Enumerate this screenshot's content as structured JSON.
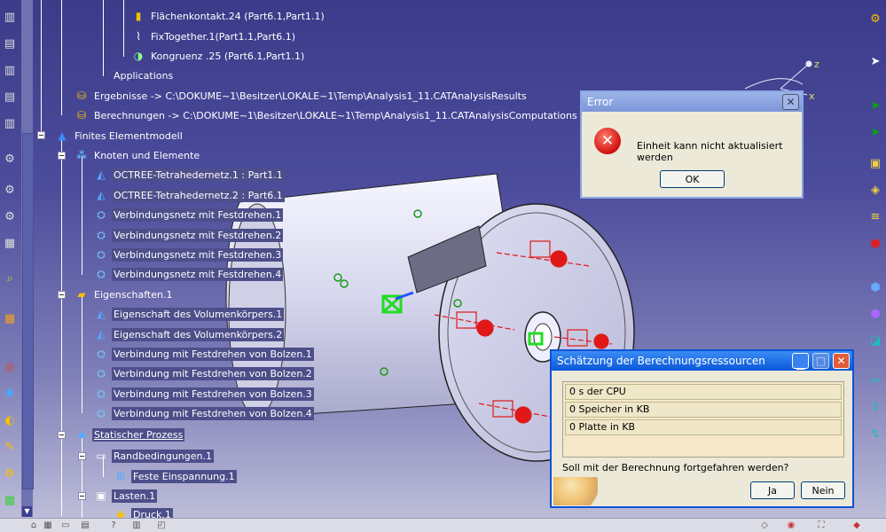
{
  "tree": {
    "rows": [
      {
        "label": "Flächenkontakt.24 (Part6.1,Part1.1)",
        "icon": "contact-icon"
      },
      {
        "label": "FixTogether.1(Part1.1,Part6.1)",
        "icon": "paperclip-icon"
      },
      {
        "label": "Kongruenz .25 (Part6.1,Part1.1)",
        "icon": "congruence-icon"
      },
      {
        "label": "Applications",
        "icon": ""
      },
      {
        "label": "Ergebnisse -> C:\\DOKUME~1\\Besitzer\\LOKALE~1\\Temp\\Analysis1_11.CATAnalysisResults",
        "icon": "results-icon"
      },
      {
        "label": "Berechnungen -> C:\\DOKUME~1\\Besitzer\\LOKALE~1\\Temp\\Analysis1_11.CATAnalysisComputations",
        "icon": "computations-icon"
      },
      {
        "label": "Finites Elementmodell",
        "icon": "fem-icon"
      },
      {
        "label": "Knoten und Elemente",
        "icon": "nodes-icon"
      },
      {
        "label": "OCTREE-Tetrahedernetz.1 : Part1.1",
        "icon": "tetra-mesh-icon"
      },
      {
        "label": "OCTREE-Tetrahedernetz.2 : Part6.1",
        "icon": "tetra-mesh-icon"
      },
      {
        "label": "Verbindungsnetz mit Festdrehen.1",
        "icon": "bolt-mesh-icon"
      },
      {
        "label": "Verbindungsnetz mit Festdrehen.2",
        "icon": "bolt-mesh-icon"
      },
      {
        "label": "Verbindungsnetz mit Festdrehen.3",
        "icon": "bolt-mesh-icon"
      },
      {
        "label": "Verbindungsnetz mit Festdrehen.4",
        "icon": "bolt-mesh-icon"
      },
      {
        "label": "Eigenschaften.1",
        "icon": "properties-folder-icon"
      },
      {
        "label": "Eigenschaft des Volumenkörpers.1",
        "icon": "solid-property-icon"
      },
      {
        "label": "Eigenschaft des Volumenkörpers.2",
        "icon": "solid-property-icon"
      },
      {
        "label": "Verbindung mit Festdrehen von Bolzen.1",
        "icon": "bolt-connection-icon"
      },
      {
        "label": "Verbindung mit Festdrehen von Bolzen.2",
        "icon": "bolt-connection-icon"
      },
      {
        "label": "Verbindung mit Festdrehen von Bolzen.3",
        "icon": "bolt-connection-icon"
      },
      {
        "label": "Verbindung mit Festdrehen von Bolzen.4",
        "icon": "bolt-connection-icon"
      },
      {
        "label": "Statischer Prozess",
        "icon": "static-case-icon"
      },
      {
        "label": "Randbedingungen.1",
        "icon": "restraints-icon"
      },
      {
        "label": "Feste Einspannung.1",
        "icon": "clamp-icon"
      },
      {
        "label": "Lasten.1",
        "icon": "loads-icon"
      },
      {
        "label": "Druck.1",
        "icon": "pressure-icon"
      }
    ]
  },
  "error_dialog": {
    "title": "Error",
    "message": "Einheit kann nicht aktualisiert werden",
    "ok_label": "OK"
  },
  "estimate_dialog": {
    "title": "Schätzung der Berechnungsressourcen",
    "rows": [
      "0 s der CPU",
      "0 Speicher in KB",
      "0 Platte in KB"
    ],
    "question": "Soll mit der Berechnung fortgefahren werden?",
    "yes_label": "Ja",
    "no_label": "Nein"
  },
  "compass": {
    "z_label": "z",
    "x_label": "x"
  },
  "colors": {
    "background_top": "#3b3b8a",
    "background_bottom": "#c3c3dc",
    "xp_title_active": "#0a57d8",
    "xp_title_inactive": "#7b96d9",
    "dialog_face": "#ece9d8",
    "bolt_red": "#e01818",
    "constraint_green": "#22dd22"
  }
}
